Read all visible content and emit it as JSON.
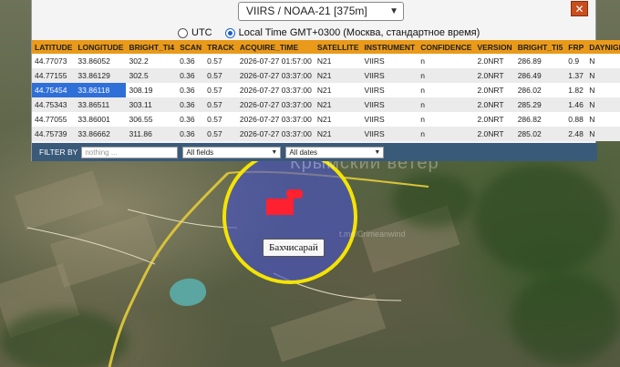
{
  "header": {
    "source_select": "VIIRS / NOAA-21 [375m]",
    "close_label": "✕"
  },
  "timezone": {
    "utc_label": "UTC",
    "local_label": "Local Time GMT+0300 (Москва, стандартное время)",
    "selected": "local"
  },
  "table": {
    "columns": [
      "LATITUDE",
      "LONGITUDE",
      "BRIGHT_TI4",
      "SCAN",
      "TRACK",
      "ACQUIRE_TIME",
      "SATELLITE",
      "INSTRUMENT",
      "CONFIDENCE",
      "VERSION",
      "BRIGHT_TI5",
      "FRP",
      "DAYNIGHT"
    ],
    "rows": [
      [
        "44.77073",
        "33.86052",
        "302.2",
        "0.36",
        "0.57",
        "2026-07-27 01:57:00",
        "N21",
        "VIIRS",
        "n",
        "2.0NRT",
        "286.89",
        "0.9",
        "N"
      ],
      [
        "44.77155",
        "33.86129",
        "302.5",
        "0.36",
        "0.57",
        "2026-07-27 03:37:00",
        "N21",
        "VIIRS",
        "n",
        "2.0NRT",
        "286.49",
        "1.37",
        "N"
      ],
      [
        "44.75454",
        "33.86118",
        "308.19",
        "0.36",
        "0.57",
        "2026-07-27 03:37:00",
        "N21",
        "VIIRS",
        "n",
        "2.0NRT",
        "286.02",
        "1.82",
        "N"
      ],
      [
        "44.75343",
        "33.86511",
        "303.11",
        "0.36",
        "0.57",
        "2026-07-27 03:37:00",
        "N21",
        "VIIRS",
        "n",
        "2.0NRT",
        "285.29",
        "1.46",
        "N"
      ],
      [
        "44.77055",
        "33.86001",
        "306.55",
        "0.36",
        "0.57",
        "2026-07-27 03:37:00",
        "N21",
        "VIIRS",
        "n",
        "2.0NRT",
        "286.82",
        "0.88",
        "N"
      ],
      [
        "44.75739",
        "33.86662",
        "311.86",
        "0.36",
        "0.57",
        "2026-07-27 03:37:00",
        "N21",
        "VIIRS",
        "n",
        "2.0NRT",
        "285.02",
        "2.48",
        "N"
      ]
    ]
  },
  "filter": {
    "label": "FILTER BY",
    "placeholder": "nothing ...",
    "fields_select": "All fields",
    "dates_select": "All dates"
  },
  "map": {
    "place_label": "Бахчисарай",
    "watermark_title": "Крымский ветер",
    "watermark_sub": "t.me/Crimeanwind",
    "zone_border_color": "#f5e400",
    "fire_color": "#ff2030"
  }
}
